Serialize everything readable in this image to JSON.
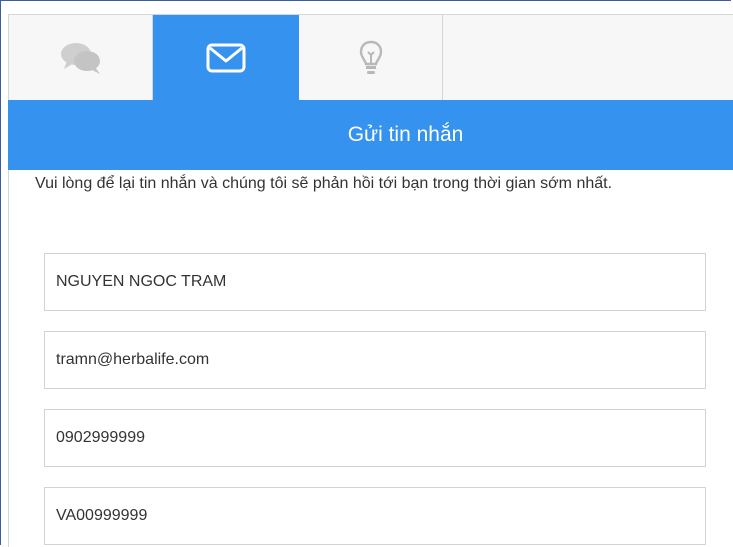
{
  "tabs": [
    {
      "name": "chat",
      "icon": "chat-bubbles-icon",
      "active": false
    },
    {
      "name": "message",
      "icon": "envelope-icon",
      "active": true
    },
    {
      "name": "tips",
      "icon": "lightbulb-icon",
      "active": false
    }
  ],
  "header": {
    "title": "Gửi tin nhắn"
  },
  "intro": {
    "text": "Vui lòng để lại tin nhắn và chúng tôi sẽ phản hồi tới bạn trong thời gian sớm nhất."
  },
  "form": {
    "name_value": "NGUYEN NGOC TRAM",
    "email_value": "tramn@herbalife.com",
    "phone_value": "0902999999",
    "id_value": "VA00999999"
  },
  "colors": {
    "accent": "#3592ef",
    "icon_inactive": "#c9c9c9",
    "border": "#d3d3d3"
  }
}
